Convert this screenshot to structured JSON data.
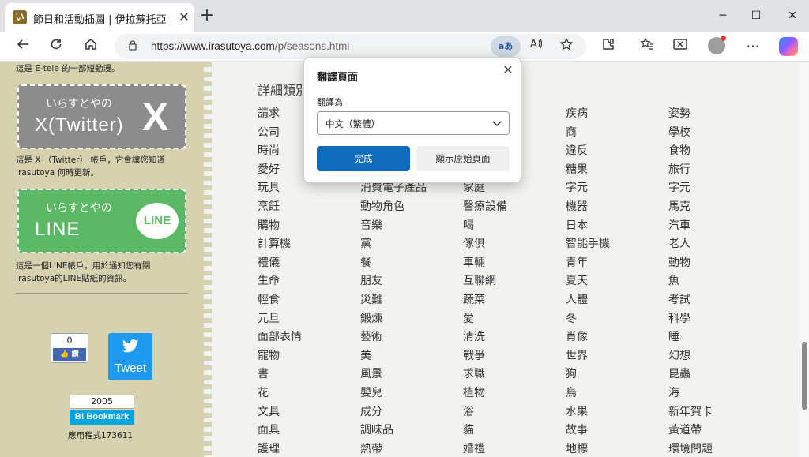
{
  "browser": {
    "tab_title": "節日和活動插圖 | 伊拉蘇托亞",
    "tab_favicon_text": "い",
    "tab_close_label": "✕",
    "new_tab_label": "+",
    "window_controls": {
      "minimize": "─",
      "maximize": "☐",
      "close": "✕"
    },
    "url_host": "https://www.irasutoya.com",
    "url_path": "/p/seasons.html",
    "translate_badge": "aあ",
    "icons": [
      "back-icon",
      "refresh-icon",
      "home-icon",
      "lock-icon",
      "read-aloud-icon",
      "favorite-star-icon",
      "extensions-icon",
      "favorites-icon",
      "screenshot-icon",
      "profile-avatar-icon",
      "copilot-icon"
    ]
  },
  "sidebar": {
    "top_text": "這是 E-tele 的一部短動漫。",
    "x_banner": {
      "sub": "いらすとやの",
      "main": "X(Twitter)",
      "logo": "X"
    },
    "x_text_1": "這是 X （Twitter） 帳戶，它會讓您知道",
    "x_text_2": "Irasutoya 何時更新。",
    "line_banner": {
      "sub": "いらすとやの",
      "main": "LINE",
      "logo": "LINE"
    },
    "line_text_1": "這是一個LINE帳戶，用於通知您有關",
    "line_text_2": "Irasutoya的LINE貼紙的資訊。",
    "fb_count": "0",
    "fb_like": "讚",
    "tweet_label": "Tweet",
    "hatena_count": "2005",
    "hatena_label": "B! Bookmark",
    "app_count": "應用程式173611"
  },
  "main": {
    "heading": "詳細類別",
    "columns": [
      [
        "請求",
        "公司",
        "時尚",
        "愛好",
        "玩具",
        "烹飪",
        "購物",
        "計算機",
        "禮儀",
        "生命",
        "輕食",
        "元旦",
        "面部表情",
        "寵物",
        "書",
        "花",
        "文具",
        "面具",
        "護理"
      ],
      [
        "",
        "",
        "",
        "",
        "消費電子產品",
        "動物角色",
        "音樂",
        "黨",
        "餐",
        "朋友",
        "災難",
        "鍛煉",
        "藝術",
        "美",
        "風景",
        "嬰兒",
        "成分",
        "調味品",
        "熱帶"
      ],
      [
        "",
        "",
        "",
        "",
        "家庭",
        "醫療設備",
        "喝",
        "傢俱",
        "車輛",
        "互聯網",
        "蔬菜",
        "愛",
        "清洗",
        "戰爭",
        "求職",
        "植物",
        "浴",
        "貓",
        "婚禮"
      ],
      [
        "疾病",
        "商",
        "違反",
        "糖果",
        "字元",
        "機器",
        "日本",
        "智能手機",
        "青年",
        "夏天",
        "人體",
        "冬",
        "肖像",
        "世界",
        "狗",
        "鳥",
        "水果",
        "故事",
        "地標"
      ],
      [
        "姿勢",
        "學校",
        "食物",
        "旅行",
        "字元",
        "馬克",
        "汽車",
        "老人",
        "動物",
        "魚",
        "考試",
        "科學",
        "睡",
        "幻想",
        "昆蟲",
        "海",
        "新年賀卡",
        "黃道帶",
        "環境問題"
      ]
    ]
  },
  "translate_popup": {
    "title": "翻譯頁面",
    "close_label": "✕",
    "target_label": "翻譯為",
    "selected_language": "中文（繁體）",
    "done_button": "完成",
    "show_original_button": "顯示原始頁面"
  }
}
